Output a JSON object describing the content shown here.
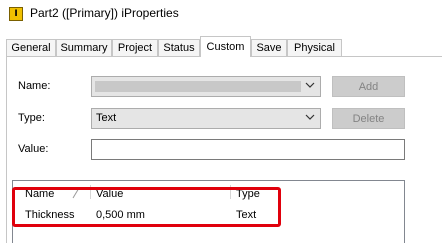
{
  "window": {
    "title": "Part2 ([Primary]) iProperties",
    "icon_letter": "I"
  },
  "tabs": [
    {
      "label": "General"
    },
    {
      "label": "Summary"
    },
    {
      "label": "Project"
    },
    {
      "label": "Status"
    },
    {
      "label": "Custom",
      "active": true
    },
    {
      "label": "Save"
    },
    {
      "label": "Physical"
    }
  ],
  "form": {
    "name_label": "Name:",
    "name_value": "",
    "type_label": "Type:",
    "type_value": "Text",
    "value_label": "Value:",
    "value_value": "",
    "add_label": "Add",
    "delete_label": "Delete"
  },
  "properties_table": {
    "columns": [
      "Name",
      "Value",
      "Type"
    ],
    "rows": [
      {
        "name": "Thickness",
        "value": "0,500 mm",
        "type": "Text"
      }
    ]
  },
  "colors": {
    "highlight": "#e0000c",
    "disabled_button": "#cccccc"
  }
}
